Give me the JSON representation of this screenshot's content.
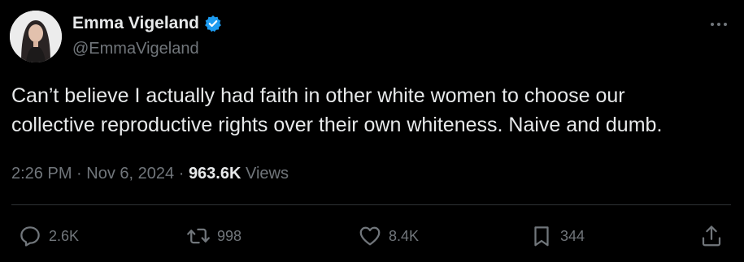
{
  "author": {
    "display_name": "Emma Vigeland",
    "handle": "@EmmaVigeland",
    "verified": true
  },
  "tweet": {
    "text_line1": "Can’t believe I actually had faith in other white women to choose our",
    "text_line2": "collective reproductive rights over their own whiteness. Naive and dumb.",
    "time": "2:26 PM",
    "date": "Nov 6, 2024",
    "separator": "·",
    "views_count": "963.6K",
    "views_label": "Views"
  },
  "actions": {
    "replies": "2.6K",
    "reposts": "998",
    "likes": "8.4K",
    "bookmarks": "344"
  },
  "icons": {
    "more": "more-horizontal-icon",
    "reply": "reply-icon",
    "repost": "repost-icon",
    "like": "heart-icon",
    "bookmark": "bookmark-icon",
    "share": "share-icon",
    "verified": "verified-badge-icon"
  },
  "colors": {
    "background": "#000000",
    "text_primary": "#e7e9ea",
    "text_secondary": "#71767b",
    "verified_blue": "#1d9bf0",
    "divider": "#2f3336"
  }
}
